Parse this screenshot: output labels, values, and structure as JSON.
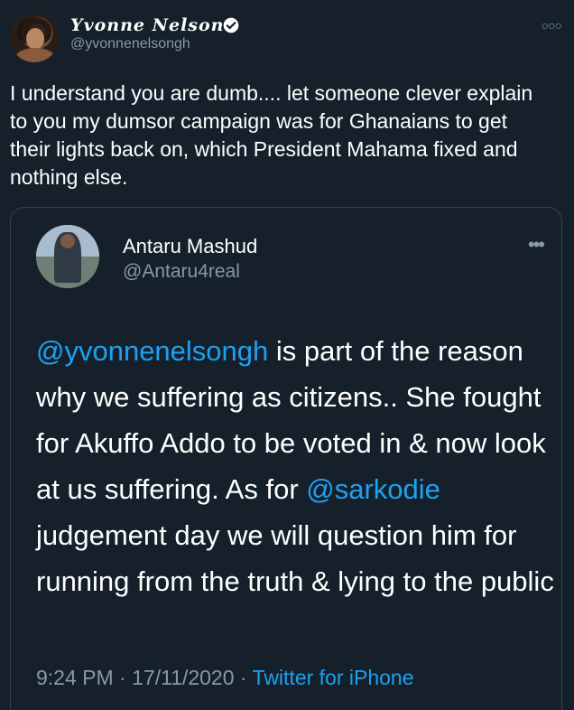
{
  "author": {
    "name": "Yvonne Nelson",
    "handle": "@yvonnenelsongh",
    "verified": true
  },
  "more_icon": "ellipsis-icon",
  "tweet": {
    "text": "I understand you are dumb.... let  someone clever explain to you my dumsor campaign was for Ghanaians to get their lights back on, which President Mahama fixed and nothing else."
  },
  "quoted_tweet": {
    "name": "Antaru Mashud",
    "handle": "@Antaru4real",
    "text_parts": {
      "mention1": "@yvonnenelsongh",
      "part1": " is part of the reason why we suffering as citizens.. She fought for Akuffo Addo to be voted in & now look at us suffering. As for ",
      "mention2": "@sarkodie",
      "part2": " judgement day we will question him for running from the truth & lying to the public"
    },
    "time": "9:24 PM",
    "separator": " · ",
    "date": "17/11/2020",
    "source": "Twitter for iPhone"
  },
  "colors": {
    "background": "#15202b",
    "link": "#1da1f2",
    "secondary_text": "#8899a6",
    "border": "#38444d"
  }
}
